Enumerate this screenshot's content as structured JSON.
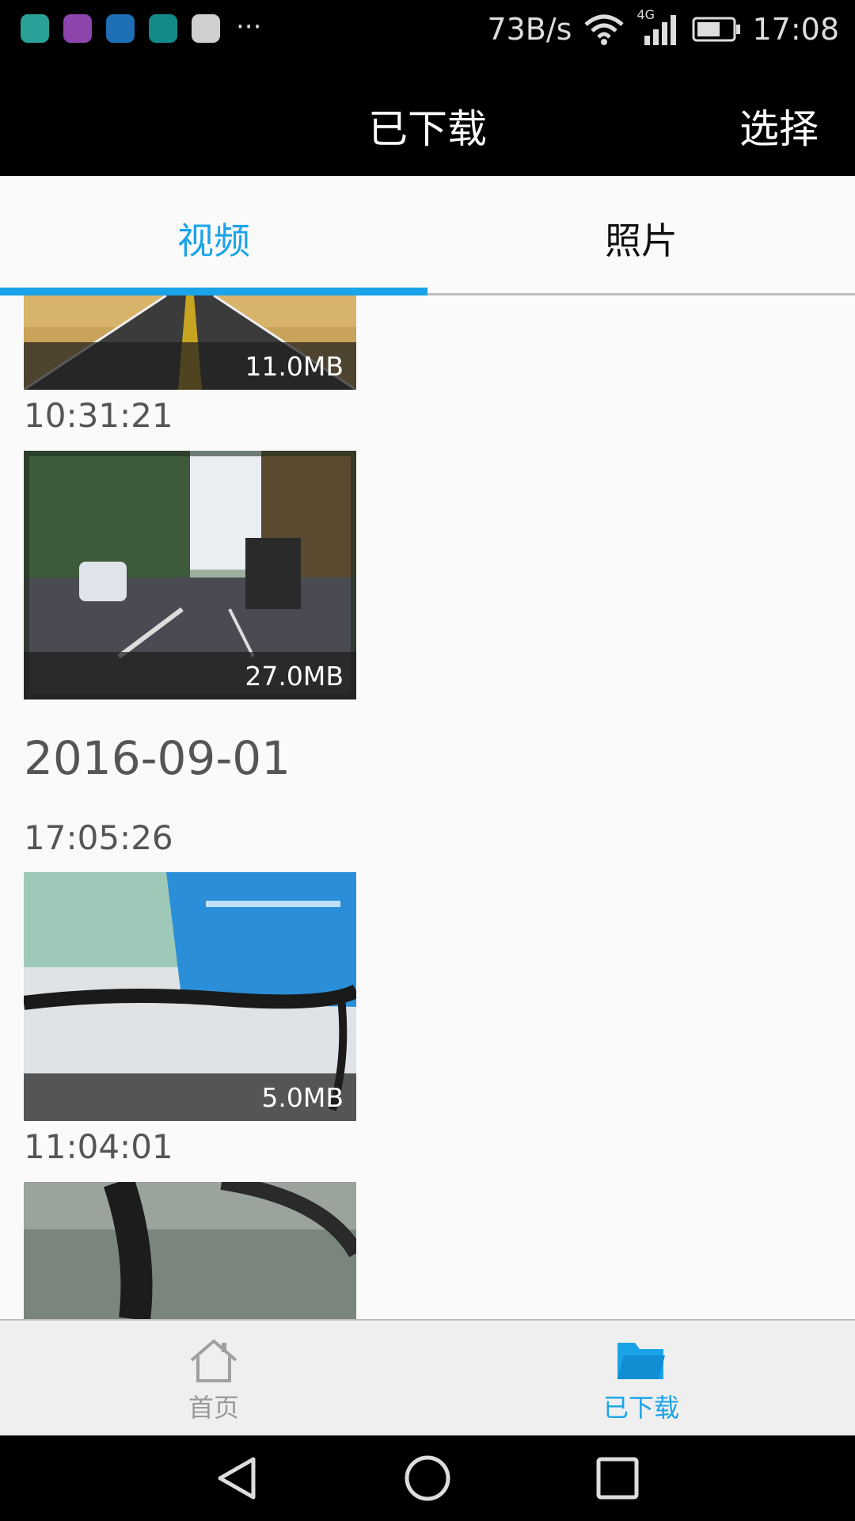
{
  "status_bar": {
    "network_speed": "73B/s",
    "network_type": "4G",
    "time": "17:08",
    "overflow": "···"
  },
  "app_bar": {
    "title": "已下载",
    "select_label": "选择"
  },
  "tabs": [
    {
      "label": "视频",
      "active": true
    },
    {
      "label": "照片",
      "active": false
    }
  ],
  "content": {
    "items": [
      {
        "type": "thumb",
        "size": "11.0MB"
      },
      {
        "type": "time",
        "text": "10:31:21"
      },
      {
        "type": "thumb",
        "size": "27.0MB"
      },
      {
        "type": "date",
        "text": "2016-09-01"
      },
      {
        "type": "time",
        "text": "17:05:26"
      },
      {
        "type": "thumb",
        "size": "5.0MB"
      },
      {
        "type": "time",
        "text": "11:04:01"
      },
      {
        "type": "thumb",
        "size": ""
      }
    ]
  },
  "bottom_nav": [
    {
      "label": "首页",
      "icon": "home-icon",
      "active": false
    },
    {
      "label": "已下载",
      "icon": "folder-icon",
      "active": true
    }
  ],
  "colors": {
    "accent": "#1aa3e8",
    "status_bar": "#000000",
    "background": "#fafafa"
  }
}
